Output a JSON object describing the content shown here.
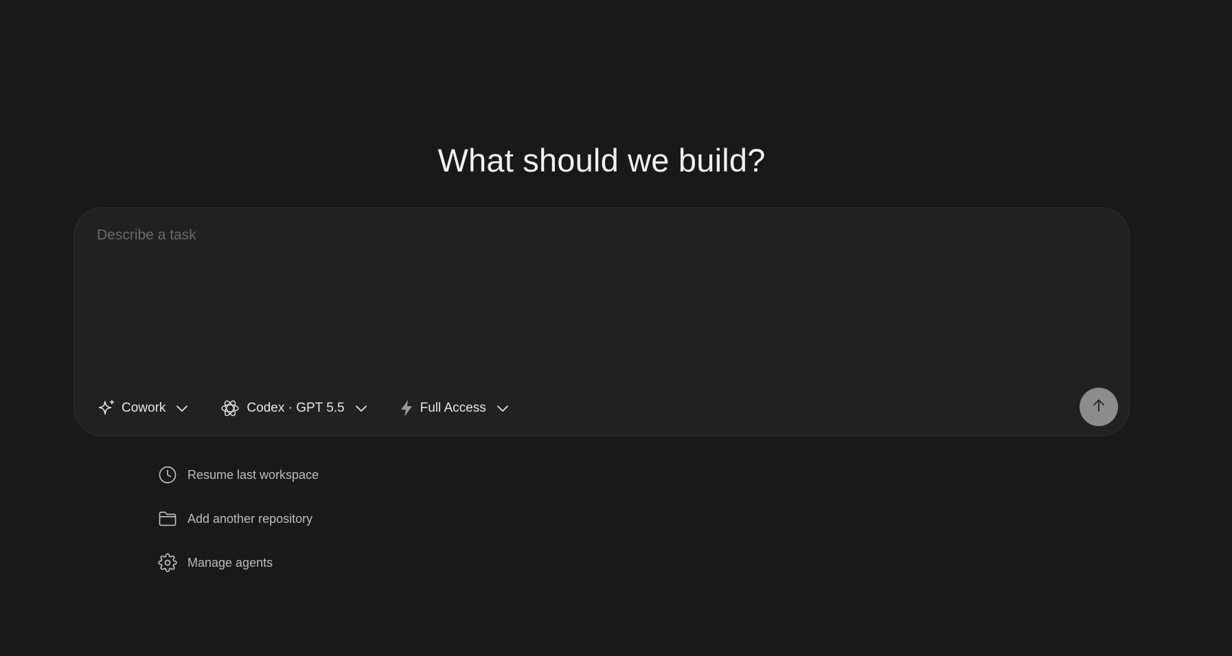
{
  "hero": {
    "title": "What should we build?"
  },
  "composer": {
    "placeholder": "Describe a task",
    "value": "",
    "mode": {
      "label": "Cowork",
      "icon": "sparkle-icon"
    },
    "model": {
      "label": "Codex · GPT 5.5",
      "icon": "openai-logo-icon"
    },
    "access": {
      "label": "Full Access",
      "icon": "lightning-bolt-icon"
    },
    "send": {
      "icon": "arrow-up-icon"
    }
  },
  "quick_actions": [
    {
      "label": "Resume last workspace",
      "icon": "clock-icon"
    },
    {
      "label": "Add another repository",
      "icon": "folder-icon"
    },
    {
      "label": "Manage agents",
      "icon": "gear-icon"
    }
  ],
  "colors": {
    "background": "#191919",
    "composer_background": "#212121",
    "send_button": "#8c8c8c"
  }
}
